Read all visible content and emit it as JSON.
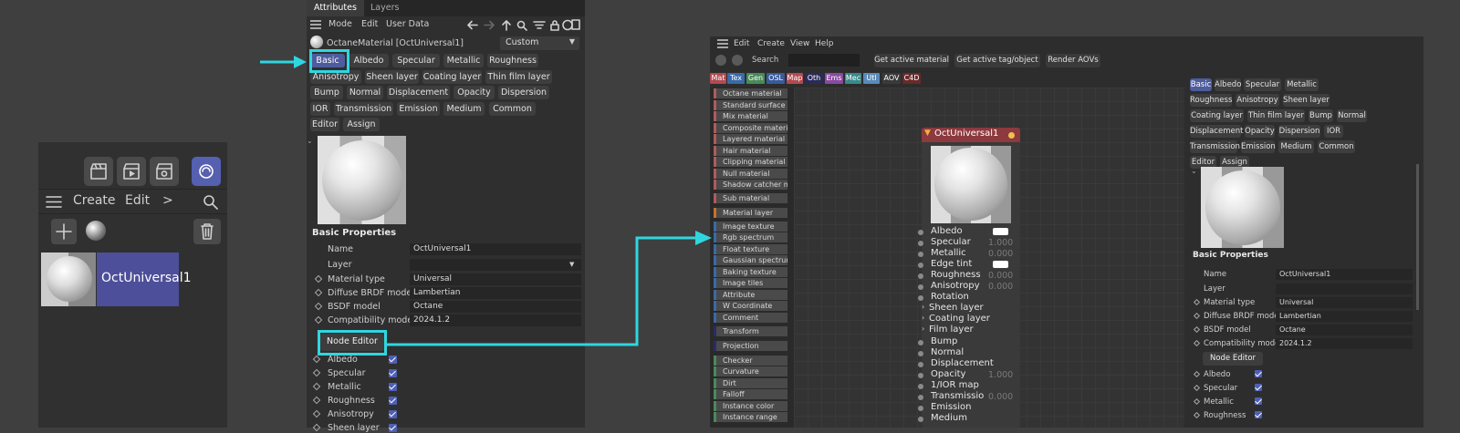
{
  "colors": {
    "accent_cyan": "#2fd6e0",
    "selected_chip": "#4e5c9e",
    "checkbox": "#4f5fb8"
  },
  "left_panel": {
    "menu": {
      "create": "Create",
      "edit": "Edit",
      "more": ">"
    },
    "material_name": "OctUniversal1"
  },
  "attributes": {
    "tabs": [
      "Attributes",
      "Layers"
    ],
    "menu": [
      "Mode",
      "Edit",
      "User Data"
    ],
    "title": "OctaneMaterial [OctUniversal1]",
    "preset": "Custom",
    "chips": [
      "Basic",
      "Albedo",
      "Specular",
      "Metallic",
      "Roughness",
      "Anisotropy",
      "Sheen layer",
      "Coating layer",
      "Thin film layer",
      "Bump",
      "Normal",
      "Displacement",
      "Opacity",
      "Dispersion",
      "IOR",
      "Transmission",
      "Emission",
      "Medium",
      "Common",
      "Editor",
      "Assign"
    ],
    "section_title": "Basic Properties",
    "props": [
      {
        "label": "Name",
        "value": "OctUniversal1"
      },
      {
        "label": "Layer",
        "value": ""
      },
      {
        "label": "Material type",
        "value": "Universal"
      },
      {
        "label": "Diffuse BRDF model",
        "value": "Lambertian"
      },
      {
        "label": "BSDF model",
        "value": "Octane"
      },
      {
        "label": "Compatibility mode",
        "value": "2024.1.2"
      }
    ],
    "node_editor_button": "Node Editor",
    "checks": [
      "Albedo",
      "Specular",
      "Metallic",
      "Roughness",
      "Anisotropy",
      "Sheen layer"
    ]
  },
  "node_editor": {
    "menu": [
      "Edit",
      "Create",
      "View",
      "Help"
    ],
    "search_label": "Search",
    "buttons": [
      "Get active material",
      "Get active tag/object",
      "Render AOVs"
    ],
    "cat_tabs": [
      {
        "label": "Mat",
        "color": "#b24a52"
      },
      {
        "label": "Tex",
        "color": "#3a6aa8"
      },
      {
        "label": "Gen",
        "color": "#4a8a5a"
      },
      {
        "label": "OSL",
        "color": "#3a5a9a"
      },
      {
        "label": "Map",
        "color": "#b24a52"
      },
      {
        "label": "Oth",
        "color": "#2a2a5a"
      },
      {
        "label": "Ems",
        "color": "#8a4aa0"
      },
      {
        "label": "Mec",
        "color": "#3a8a8a"
      },
      {
        "label": "Utl",
        "color": "#5a8ab8"
      },
      {
        "label": "AOV",
        "color": "#3a3a3a"
      },
      {
        "label": "C4D",
        "color": "#6a2a2a"
      }
    ],
    "node_list": [
      {
        "label": "Octane material",
        "color": "#b05a5a"
      },
      {
        "label": "Standard surface",
        "color": "#b05a5a"
      },
      {
        "label": "Mix material",
        "color": "#b05a5a"
      },
      {
        "label": "Composite material",
        "color": "#b05a5a"
      },
      {
        "label": "Layered material",
        "color": "#b05a5a"
      },
      {
        "label": "Hair material",
        "color": "#b05a5a"
      },
      {
        "label": "Clipping material",
        "color": "#b05a5a"
      },
      {
        "label": "Null material",
        "color": "#b05a5a"
      },
      {
        "label": "Shadow catcher m",
        "color": "#b05a5a"
      },
      {
        "label": "Sub material",
        "color": "#b05a5a"
      },
      {
        "label": "Material layer",
        "color": "#c8702a"
      },
      {
        "label": "Image texture",
        "color": "#3a6aa8"
      },
      {
        "label": "Rgb spectrum",
        "color": "#3a6aa8"
      },
      {
        "label": "Float texture",
        "color": "#3a6aa8"
      },
      {
        "label": "Gaussian spectrum",
        "color": "#3a6aa8"
      },
      {
        "label": "Baking texture",
        "color": "#3a6aa8"
      },
      {
        "label": "Image tiles",
        "color": "#3a6aa8"
      },
      {
        "label": "Attribute",
        "color": "#3a6aa8"
      },
      {
        "label": "W Coordinate",
        "color": "#3a6aa8"
      },
      {
        "label": "Comment",
        "color": "#3a6aa8"
      },
      {
        "label": "Transform",
        "color": "#2a2a6a"
      },
      {
        "label": "Projection",
        "color": "#2a2a6a"
      },
      {
        "label": "Checker",
        "color": "#4a8a5a"
      },
      {
        "label": "Curvature",
        "color": "#4a8a5a"
      },
      {
        "label": "Dirt",
        "color": "#4a8a5a"
      },
      {
        "label": "Falloff",
        "color": "#4a8a5a"
      },
      {
        "label": "Instance color",
        "color": "#4a8a5a"
      },
      {
        "label": "Instance range",
        "color": "#4a8a5a"
      }
    ],
    "node": {
      "title": "OctUniversal1",
      "ports": [
        {
          "label": "Albedo",
          "value": "",
          "swatch": true
        },
        {
          "label": "Specular",
          "value": "1.000"
        },
        {
          "label": "Metallic",
          "value": "0.000"
        },
        {
          "label": "Edge tint",
          "value": "",
          "swatch": true
        },
        {
          "label": "Roughness",
          "value": "0.000"
        },
        {
          "label": "Anisotropy",
          "value": "0.000"
        },
        {
          "label": "Rotation",
          "value": ""
        },
        {
          "label": "Sheen layer",
          "value": "",
          "group": true
        },
        {
          "label": "Coating layer",
          "value": "",
          "group": true
        },
        {
          "label": "Film layer",
          "value": "",
          "group": true
        },
        {
          "label": "Bump",
          "value": ""
        },
        {
          "label": "Normal",
          "value": ""
        },
        {
          "label": "Displacement",
          "value": ""
        },
        {
          "label": "Opacity",
          "value": "1.000"
        },
        {
          "label": "1/IOR map",
          "value": ""
        },
        {
          "label": "Transmissio",
          "value": "0.000"
        },
        {
          "label": "Emission",
          "value": ""
        },
        {
          "label": "Medium",
          "value": ""
        }
      ]
    },
    "side_panel": {
      "chips": [
        "Basic",
        "Albedo",
        "Specular",
        "Metallic",
        "Roughness",
        "Anisotropy",
        "Sheen layer",
        "Coating layer",
        "Thin film layer",
        "Bump",
        "Normal",
        "Displacement",
        "Opacity",
        "Dispersion",
        "IOR",
        "Transmission",
        "Emission",
        "Medium",
        "Common",
        "Editor",
        "Assign"
      ],
      "section_title": "Basic Properties",
      "props": [
        {
          "label": "Name",
          "value": "OctUniversal1"
        },
        {
          "label": "Layer",
          "value": ""
        },
        {
          "label": "Material type",
          "value": "Universal"
        },
        {
          "label": "Diffuse BRDF model",
          "value": "Lambertian"
        },
        {
          "label": "BSDF model",
          "value": "Octane"
        },
        {
          "label": "Compatibility mode",
          "value": "2024.1.2"
        }
      ],
      "node_editor_button": "Node Editor",
      "checks": [
        "Albedo",
        "Specular",
        "Metallic",
        "Roughness"
      ]
    }
  }
}
